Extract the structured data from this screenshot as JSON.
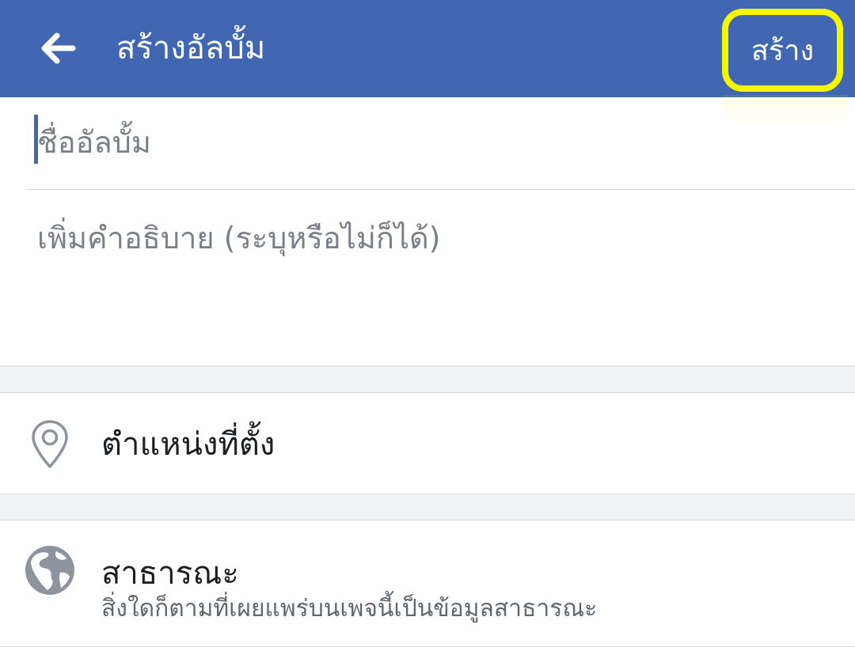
{
  "header": {
    "back_icon": "arrow-left-icon",
    "title": "สร้างอัลบั้ม",
    "create_label": "สร้าง",
    "highlight_color": "#f5f500",
    "bar_color": "#4267b2"
  },
  "form": {
    "name_placeholder": "ชื่ออัลบั้ม",
    "description_placeholder": "เพิ่มคำอธิบาย (ระบุหรือไม่ก็ได้)"
  },
  "location": {
    "icon": "location-pin-icon",
    "label": "ตำแหน่งที่ตั้ง"
  },
  "privacy": {
    "icon": "globe-icon",
    "title": "สาธารณะ",
    "subtitle": "สิ่งใดก็ตามที่เผยแพร่บนเพจนี้เป็นข้อมูลสาธารณะ"
  }
}
